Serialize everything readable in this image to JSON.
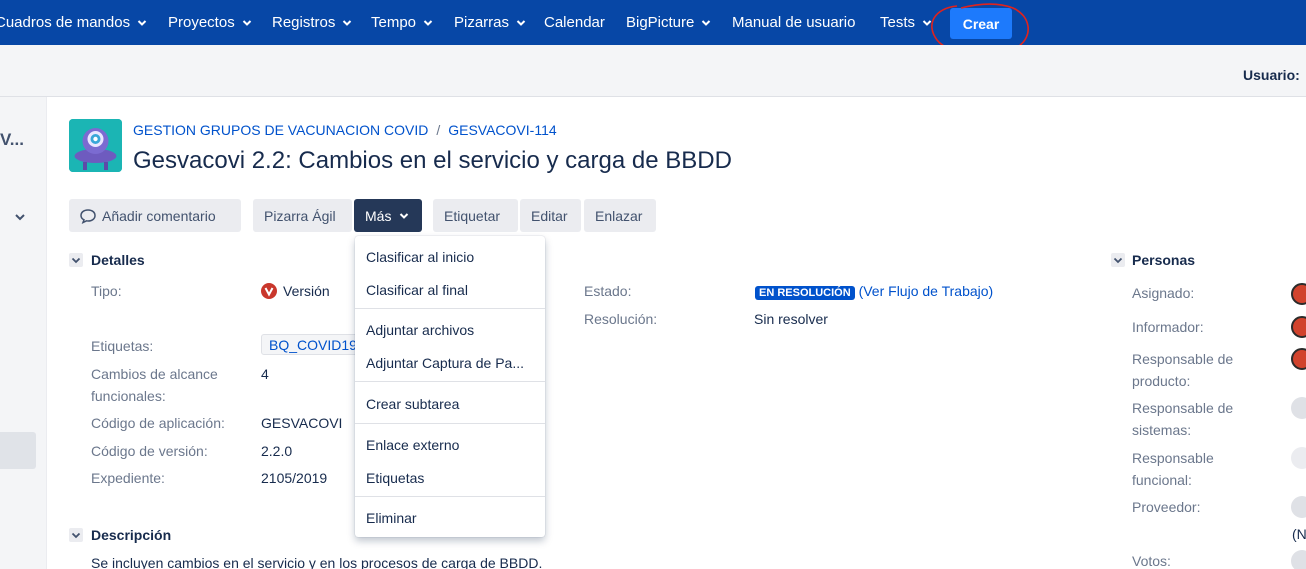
{
  "nav": {
    "items": [
      {
        "label": "Cuadros de mandos",
        "chevron": true
      },
      {
        "label": "Proyectos",
        "chevron": true
      },
      {
        "label": "Registros",
        "chevron": true
      },
      {
        "label": "Tempo",
        "chevron": true
      },
      {
        "label": "Pizarras",
        "chevron": true
      },
      {
        "label": "Calendar",
        "chevron": false
      },
      {
        "label": "BigPicture",
        "chevron": true
      },
      {
        "label": "Manual de usuario",
        "chevron": false
      },
      {
        "label": "Tests",
        "chevron": true
      }
    ],
    "create_label": "Crear",
    "bg_color": "#0747a6"
  },
  "header": {
    "user_label": "Usuario:"
  },
  "sidebar": {
    "title": "V..."
  },
  "issue": {
    "project_name": "GESTION GRUPOS DE VACUNACION COVID",
    "key": "GESVACOVI-114",
    "title": "Gesvacovi 2.2: Cambios en el servicio y carga de BBDD"
  },
  "toolbar": {
    "comment": "Añadir comentario",
    "agile": "Pizarra Ágil",
    "more": "Más",
    "label": "Etiquetar",
    "edit": "Editar",
    "link": "Enlazar"
  },
  "details": {
    "heading": "Detalles",
    "tipo_label": "Tipo:",
    "tipo_value": "Versión",
    "etiquetas_label": "Etiquetas:",
    "etiquetas_value": "BQ_COVID19",
    "cambios_label_1": "Cambios de alcance",
    "cambios_label_2": "funcionales:",
    "cambios_value": "4",
    "codigo_app_label": "Código de aplicación:",
    "codigo_app_value": "GESVACOVI",
    "codigo_ver_label": "Código de versión:",
    "codigo_ver_value": "2.2.0",
    "expediente_label": "Expediente:",
    "expediente_value": "2105/2019",
    "estado_label": "Estado:",
    "estado_value": "EN RESOLUCIÓN",
    "workflow_link": "(Ver Flujo de Trabajo)",
    "resolucion_label": "Resolución:",
    "resolucion_value": "Sin resolver"
  },
  "description": {
    "heading": "Descripción",
    "text": "Se incluyen cambios en el servicio y en los procesos de carga de BBDD."
  },
  "more_menu": {
    "items": [
      "Clasificar al inicio",
      "Clasificar al final",
      "Adjuntar archivos",
      "Adjuntar Captura de Pa...",
      "Crear subtarea",
      "Enlace externo",
      "Etiquetas",
      "Eliminar"
    ]
  },
  "people": {
    "heading": "Personas",
    "asignado": "Asignado:",
    "informador": "Informador:",
    "resp_producto_1": "Responsable de",
    "resp_producto_2": "producto:",
    "resp_sistemas_1": "Responsable de",
    "resp_sistemas_2": "sistemas:",
    "resp_funcional_1": "Responsable",
    "resp_funcional_2": "funcional:",
    "proveedor": "Proveedor:",
    "proveedor_extra": "(N",
    "votos": "Votos:"
  }
}
